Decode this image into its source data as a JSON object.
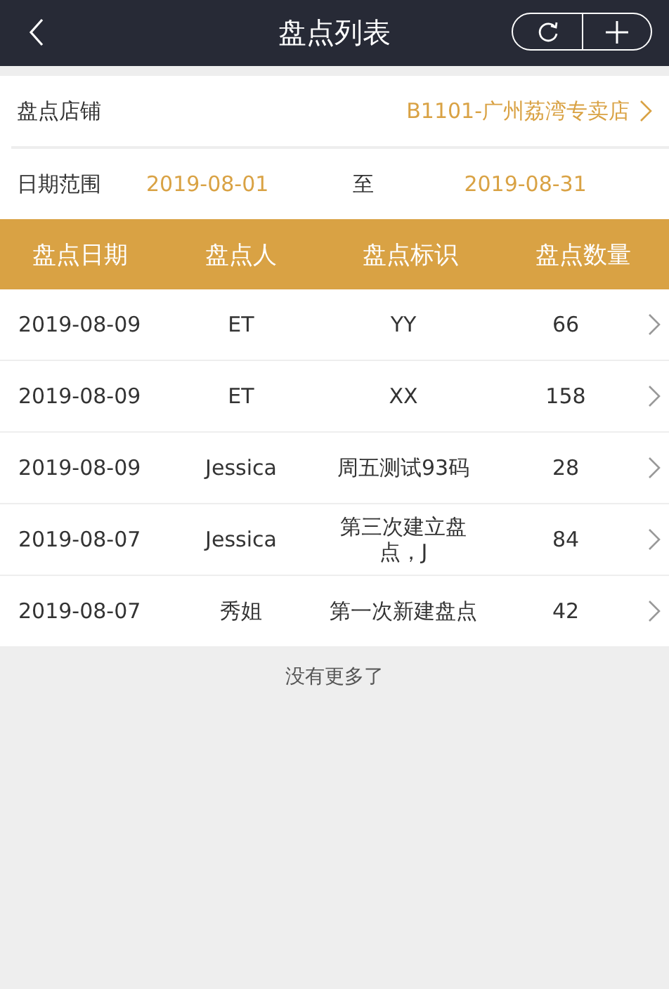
{
  "header": {
    "title": "盘点列表"
  },
  "filters": {
    "store_label": "盘点店铺",
    "store_value": "B1101-广州荔湾专卖店",
    "date_label": "日期范围",
    "date_from": "2019-08-01",
    "date_sep": "至",
    "date_to": "2019-08-31"
  },
  "table": {
    "columns": [
      "盘点日期",
      "盘点人",
      "盘点标识",
      "盘点数量"
    ],
    "rows": [
      {
        "date": "2019-08-09",
        "person": "ET",
        "tag": "YY",
        "count": "66"
      },
      {
        "date": "2019-08-09",
        "person": "ET",
        "tag": "XX",
        "count": "158"
      },
      {
        "date": "2019-08-09",
        "person": "Jessica",
        "tag": "周五测试93码",
        "count": "28"
      },
      {
        "date": "2019-08-07",
        "person": "Jessica",
        "tag": "第三次建立盘点，J",
        "count": "84"
      },
      {
        "date": "2019-08-07",
        "person": "秀姐",
        "tag": "第一次新建盘点",
        "count": "42"
      }
    ]
  },
  "footer": "没有更多了"
}
